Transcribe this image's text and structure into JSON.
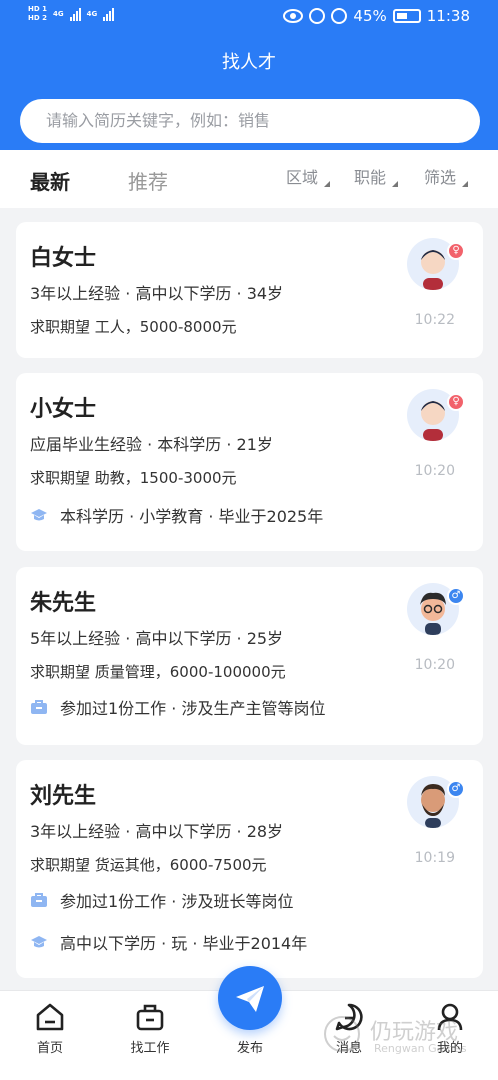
{
  "status_bar": {
    "network_a": "HD 1",
    "network_b": "HD 2",
    "gen_a": "4G",
    "gen_b": "4G",
    "battery_percent": "45%",
    "time": "11:38"
  },
  "header": {
    "title": "找人才",
    "search_placeholder": "请输入简历关键字，例如：销售"
  },
  "filters": {
    "tab_latest": "最新",
    "tab_recommended": "推荐",
    "region": "区域",
    "position": "职能",
    "filter": "筛选"
  },
  "candidates": [
    {
      "name": "白女士",
      "info": "3年以上经验 · 高中以下学历 · 34岁",
      "expect": "求职期望 工人，5000-8000元",
      "time": "10:22",
      "gender": "female",
      "extras": []
    },
    {
      "name": "小女士",
      "info": "应届毕业生经验 · 本科学历 · 21岁",
      "expect": "求职期望 助教，1500-3000元",
      "time": "10:20",
      "gender": "female",
      "extras": [
        {
          "icon": "graduation-cap-icon",
          "text": "本科学历 · 小学教育 · 毕业于2025年"
        }
      ]
    },
    {
      "name": "朱先生",
      "info": "5年以上经验 · 高中以下学历 · 25岁",
      "expect": "求职期望 质量管理，6000-100000元",
      "time": "10:20",
      "gender": "male",
      "extras": [
        {
          "icon": "briefcase-icon",
          "text": "参加过1份工作 · 涉及生产主管等岗位"
        }
      ]
    },
    {
      "name": "刘先生",
      "info": "3年以上经验 · 高中以下学历 · 28岁",
      "expect": "求职期望 货运其他，6000-7500元",
      "time": "10:19",
      "gender": "male",
      "extras": [
        {
          "icon": "briefcase-icon",
          "text": "参加过1份工作 · 涉及班长等岗位"
        },
        {
          "icon": "graduation-cap-icon",
          "text": "高中以下学历 · 玩 · 毕业于2014年"
        }
      ]
    }
  ],
  "nav": {
    "home": "首页",
    "find_job": "找工作",
    "publish": "发布",
    "messages": "消息",
    "mine": "我的"
  },
  "watermark": {
    "cn": "仍玩游戏",
    "en": "Rengwan Games"
  },
  "colors": {
    "primary": "#2a7cf6",
    "female_badge": "#f2626b",
    "male_badge": "#3c86f0",
    "icon_light_blue": "#8fb6f2"
  }
}
